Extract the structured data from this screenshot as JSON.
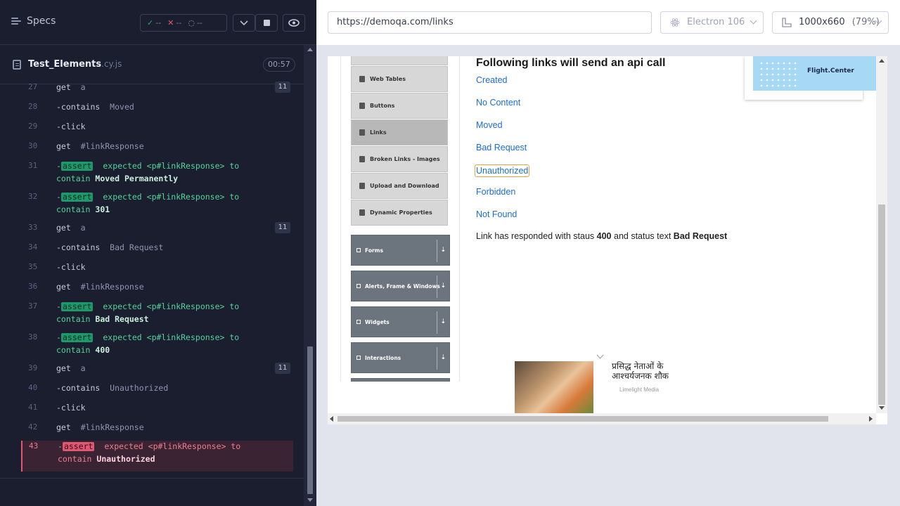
{
  "reporter": {
    "specs_label": "Specs",
    "stats": {
      "passed": "--",
      "failed": "--",
      "pending": "--"
    },
    "spec_file": {
      "name": "Test_Elements",
      "ext": ".cy.js",
      "duration": "00:57"
    },
    "commands": [
      {
        "num": "27",
        "name": "get",
        "arg": "a",
        "count": "11"
      },
      {
        "num": "28",
        "name": "-contains",
        "arg": "Moved"
      },
      {
        "num": "29",
        "name": "-click",
        "arg": ""
      },
      {
        "num": "30",
        "name": "get",
        "arg": "#linkResponse"
      },
      {
        "num": "31",
        "type": "assert",
        "badge": "assert",
        "line1": "expected <p#linkResponse> to",
        "line2_prefix": "contain",
        "value": "Moved Permanently"
      },
      {
        "num": "32",
        "type": "assert",
        "badge": "assert",
        "line1": "expected <p#linkResponse> to",
        "line2_prefix": "contain",
        "value": "301"
      },
      {
        "num": "33",
        "name": "get",
        "arg": "a",
        "count": "11"
      },
      {
        "num": "34",
        "name": "-contains",
        "arg": "Bad Request"
      },
      {
        "num": "35",
        "name": "-click",
        "arg": ""
      },
      {
        "num": "36",
        "name": "get",
        "arg": "#linkResponse"
      },
      {
        "num": "37",
        "type": "assert",
        "badge": "assert",
        "line1": "expected <p#linkResponse> to",
        "line2_prefix": "contain",
        "value": "Bad Request"
      },
      {
        "num": "38",
        "type": "assert",
        "badge": "assert",
        "line1": "expected <p#linkResponse> to",
        "line2_prefix": "contain",
        "value": "400"
      },
      {
        "num": "39",
        "name": "get",
        "arg": "a",
        "count": "11"
      },
      {
        "num": "40",
        "name": "-contains",
        "arg": "Unauthorized"
      },
      {
        "num": "41",
        "name": "-click",
        "arg": ""
      },
      {
        "num": "42",
        "name": "get",
        "arg": "#linkResponse"
      },
      {
        "num": "43",
        "type": "assert-failed",
        "badge": "assert",
        "line1": "expected <p#linkResponse> to",
        "line2_prefix": "contain",
        "value": "Unauthorized"
      }
    ]
  },
  "browser_bar": {
    "url": "https://demoqa.com/links",
    "browser": "Electron 106",
    "viewport": "1000x660",
    "zoom": "(79%)"
  },
  "app": {
    "sidebar_items": [
      {
        "label": "Web Tables",
        "active": false
      },
      {
        "label": "Buttons",
        "active": false
      },
      {
        "label": "Links",
        "active": true
      },
      {
        "label": "Broken Links - Images",
        "active": false
      },
      {
        "label": "Upload and Download",
        "active": false
      },
      {
        "label": "Dynamic Properties",
        "active": false
      }
    ],
    "sidebar_groups": [
      "Forms",
      "Alerts, Frame & Windows",
      "Widgets",
      "Interactions"
    ],
    "heading": "Following links will send an api call",
    "links": [
      "Created",
      "No Content",
      "Moved",
      "Bad Request",
      "Unauthorized",
      "Forbidden",
      "Not Found"
    ],
    "response": {
      "prefix": "Link has responded with staus",
      "code": "400",
      "middle": "and status text",
      "text": "Bad Request"
    },
    "ad_top_brand": "Flight.Center",
    "ad_bottom": {
      "title": "प्रसिद्ध नेताओं के आश्चर्यजनक शौक",
      "source": "Limelight Media"
    }
  },
  "colors": {
    "accent_green": "#1fa971",
    "accent_red": "#e45770",
    "link_blue": "#1a6dd6",
    "focus_orange": "#e8a23a"
  }
}
